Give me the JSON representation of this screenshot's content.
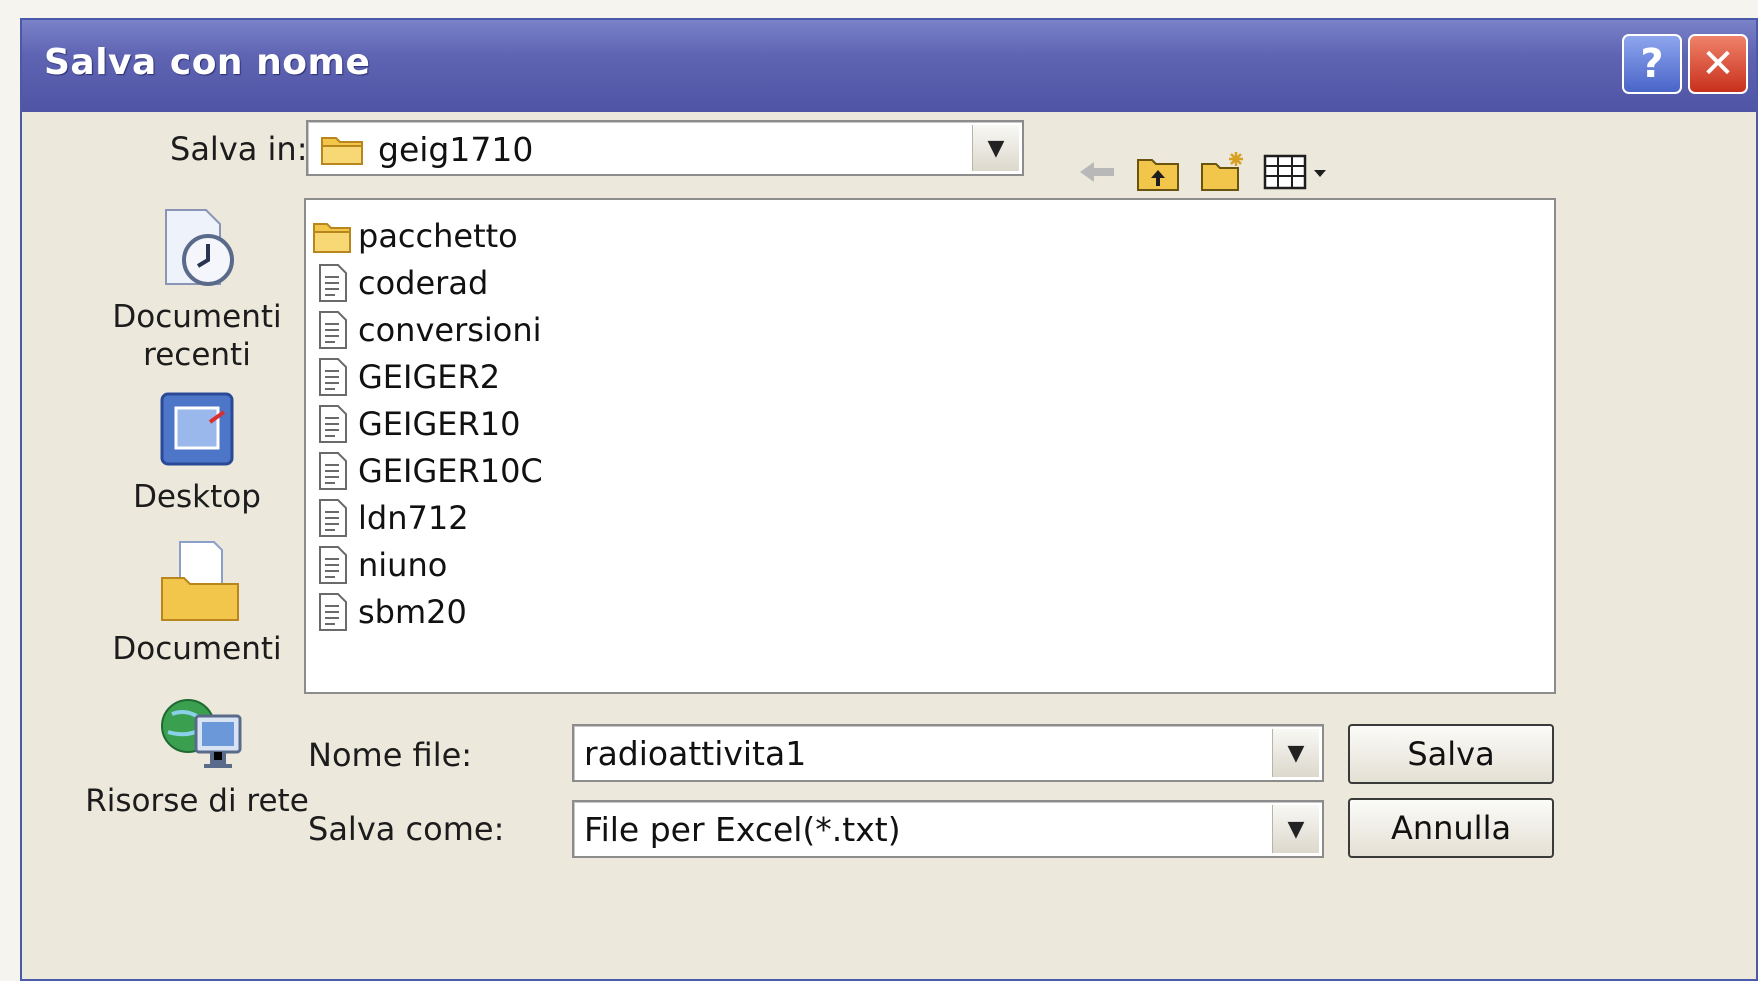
{
  "window": {
    "title": "Salva con nome",
    "help_label": "?",
    "close_label": "✕"
  },
  "save_in": {
    "label": "Salva in:",
    "value": "geig1710",
    "icon": "folder-icon"
  },
  "toolbar": {
    "icons": [
      "back-arrow-icon",
      "up-folder-icon",
      "new-folder-icon",
      "view-menu-icon"
    ]
  },
  "places": [
    {
      "label_line1": "Documenti",
      "label_line2": "recenti",
      "icon": "recent-documents-icon"
    },
    {
      "label_line1": "Desktop",
      "label_line2": "",
      "icon": "desktop-icon"
    },
    {
      "label_line1": "Documenti",
      "label_line2": "",
      "icon": "documents-icon"
    },
    {
      "label_line1": "Risorse di rete",
      "label_line2": "",
      "icon": "network-icon"
    }
  ],
  "files": [
    {
      "name": "pacchetto",
      "type": "folder"
    },
    {
      "name": "coderad",
      "type": "file"
    },
    {
      "name": "conversioni",
      "type": "file"
    },
    {
      "name": "GEIGER2",
      "type": "file"
    },
    {
      "name": "GEIGER10",
      "type": "file"
    },
    {
      "name": "GEIGER10C",
      "type": "file"
    },
    {
      "name": "ldn712",
      "type": "file"
    },
    {
      "name": "niuno",
      "type": "file"
    },
    {
      "name": "sbm20",
      "type": "file"
    }
  ],
  "filename": {
    "label": "Nome file:",
    "value": "radioattivita1"
  },
  "filetype": {
    "label": "Salva come:",
    "value": "File per Excel(*.txt)"
  },
  "buttons": {
    "save": "Salva",
    "cancel": "Annulla"
  },
  "colors": {
    "titlebar": "#5e63b2",
    "dialog_bg": "#ece8dc",
    "folder": "#f2c64a"
  }
}
